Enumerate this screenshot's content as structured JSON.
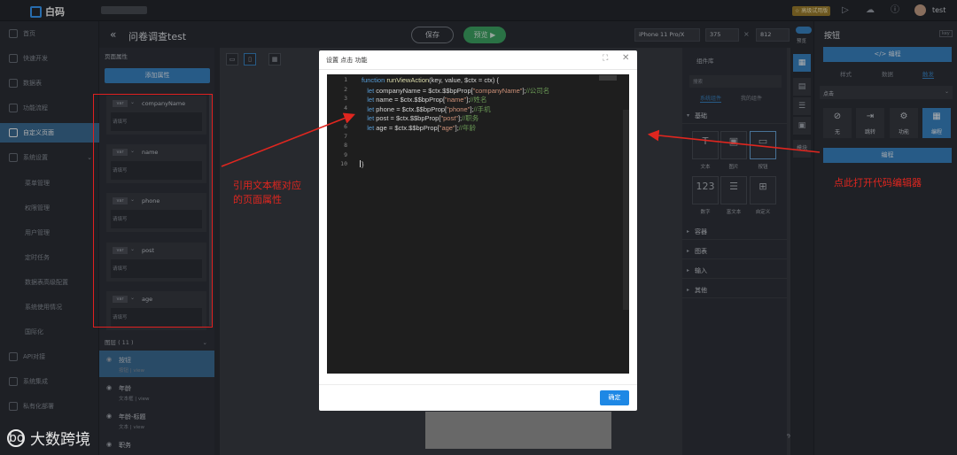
{
  "app": {
    "logo_text": "白码"
  },
  "topbar": {
    "vip_badge": "☆ 高级试用版",
    "user_name": "test"
  },
  "nav": [
    {
      "label": "首页",
      "active": false,
      "sub": false
    },
    {
      "label": "快速开发",
      "active": false,
      "sub": false
    },
    {
      "label": "数据表",
      "active": false,
      "sub": false
    },
    {
      "label": "功能流程",
      "active": false,
      "sub": false
    },
    {
      "label": "自定义页面",
      "active": true,
      "sub": false
    },
    {
      "label": "系统设置",
      "active": false,
      "sub": false,
      "expanded": true
    },
    {
      "label": "菜单管理",
      "active": false,
      "sub": true
    },
    {
      "label": "权限管理",
      "active": false,
      "sub": true
    },
    {
      "label": "用户管理",
      "active": false,
      "sub": true
    },
    {
      "label": "定时任务",
      "active": false,
      "sub": true
    },
    {
      "label": "数据表高级配置",
      "active": false,
      "sub": true
    },
    {
      "label": "系统使用情况",
      "active": false,
      "sub": true
    },
    {
      "label": "国际化",
      "active": false,
      "sub": true
    },
    {
      "label": "API对接",
      "active": false,
      "sub": false
    },
    {
      "label": "系统集成",
      "active": false,
      "sub": false
    },
    {
      "label": "私有化部署",
      "active": false,
      "sub": false
    }
  ],
  "header": {
    "back_icon": "«",
    "page_title": "问卷调查test",
    "save_label": "保存",
    "preview_label": "预览 ▶",
    "device": "iPhone 11 Pro/X",
    "width": "375",
    "height": "812"
  },
  "page_props": {
    "header": "页面属性",
    "add_label": "添加属性",
    "items": [
      {
        "type": "var",
        "name": "companyName",
        "placeholder": "请填写"
      },
      {
        "type": "var",
        "name": "name",
        "placeholder": "请填写"
      },
      {
        "type": "var",
        "name": "phone",
        "placeholder": "请填写"
      },
      {
        "type": "var",
        "name": "post",
        "placeholder": "请填写"
      },
      {
        "type": "var",
        "name": "age",
        "placeholder": "请填写"
      }
    ]
  },
  "layers": {
    "header": "图层 ( 11 )",
    "items": [
      {
        "title": "按钮",
        "meta": "按钮  |  view",
        "active": true
      },
      {
        "title": "年龄",
        "meta": "文本框  |  view",
        "active": false
      },
      {
        "title": "年龄-标题",
        "meta": "文本  |  view",
        "active": false
      },
      {
        "title": "职务",
        "meta": "",
        "active": false
      }
    ]
  },
  "modal": {
    "title": "设置 点击 功能",
    "expand_icon": "⛶",
    "close_icon": "✕",
    "ok_label": "确定",
    "code_lines": [
      {
        "n": "1",
        "segments": [
          [
            "kw",
            "function "
          ],
          [
            "fn",
            "runViewAction"
          ],
          [
            "pl",
            "(key, value, $ctx = ctx) {"
          ]
        ]
      },
      {
        "n": "2",
        "segments": [
          [
            "kw",
            "   let "
          ],
          [
            "pl",
            "companyName = $ctx.$$bpProp["
          ],
          [
            "str",
            "\"companyName\""
          ],
          [
            "pl",
            "];"
          ],
          [
            "cm",
            "//公司名"
          ]
        ]
      },
      {
        "n": "3",
        "segments": [
          [
            "kw",
            "   let "
          ],
          [
            "pl",
            "name = $ctx.$$bpProp["
          ],
          [
            "str",
            "\"name\""
          ],
          [
            "pl",
            "];"
          ],
          [
            "cm",
            "//姓名"
          ]
        ]
      },
      {
        "n": "4",
        "segments": [
          [
            "kw",
            "   let "
          ],
          [
            "pl",
            "phone = $ctx.$$bpProp["
          ],
          [
            "str",
            "\"phone\""
          ],
          [
            "pl",
            "];"
          ],
          [
            "cm",
            "//手机"
          ]
        ]
      },
      {
        "n": "5",
        "segments": [
          [
            "kw",
            "   let "
          ],
          [
            "pl",
            "post = $ctx.$$bpProp["
          ],
          [
            "str",
            "\"post\""
          ],
          [
            "pl",
            "];"
          ],
          [
            "cm",
            "//职务"
          ]
        ]
      },
      {
        "n": "6",
        "segments": [
          [
            "kw",
            "   let "
          ],
          [
            "pl",
            "age = $ctx.$$bpProp["
          ],
          [
            "str",
            "\"age\""
          ],
          [
            "pl",
            "];"
          ],
          [
            "cm",
            "//年龄"
          ]
        ]
      },
      {
        "n": "7",
        "segments": []
      },
      {
        "n": "8",
        "segments": []
      },
      {
        "n": "9",
        "segments": []
      },
      {
        "n": "10",
        "segments": [
          [
            "pl",
            "}"
          ]
        ]
      }
    ]
  },
  "components": {
    "title": "组件库",
    "search_placeholder": "搜索",
    "tab_system": "系统组件",
    "tab_mine": "我的组件",
    "sections": [
      "基础",
      "容器",
      "图表",
      "输入",
      "其他"
    ],
    "tiles": [
      {
        "glyph": "T",
        "label": "文本"
      },
      {
        "glyph": "▣",
        "label": "图片"
      },
      {
        "glyph": "▭",
        "label": "按钮"
      },
      {
        "glyph": "123",
        "label": "数字"
      },
      {
        "glyph": "☰",
        "label": "富文本"
      },
      {
        "glyph": "⊞",
        "label": "自定义"
      }
    ],
    "zoom": "%  +"
  },
  "strip": {
    "toggle_label": "预览",
    "side_label": "模块"
  },
  "right_panel": {
    "title": "按钮",
    "key_badge": "key",
    "code_btn": "</> 编程",
    "tabs": [
      "样式",
      "数据",
      "触发"
    ],
    "event": "点击",
    "actions": [
      {
        "glyph": "⊘",
        "label": "无"
      },
      {
        "glyph": "⇥",
        "label": "跳转"
      },
      {
        "glyph": "⚙",
        "label": "功能"
      },
      {
        "glyph": "▦",
        "label": "编程"
      }
    ],
    "program_btn": "编程"
  },
  "annotations": {
    "left_text": "引用文本框对应\n的页面属性",
    "right_text": "点此打开代码编辑器",
    "color": "#e0261f"
  },
  "watermark": {
    "text": "大数跨境",
    "mark": "bo"
  }
}
